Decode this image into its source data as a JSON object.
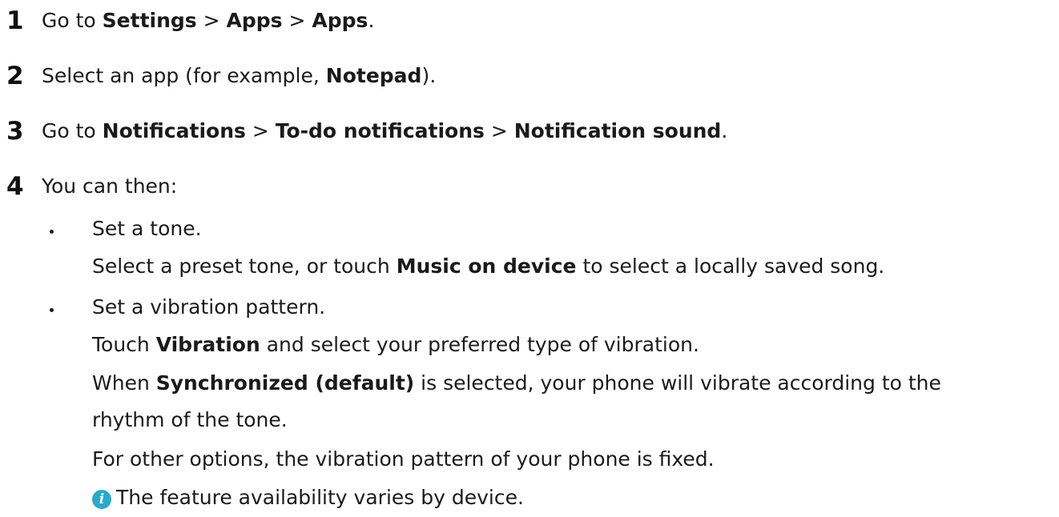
{
  "steps": [
    {
      "number": "1",
      "parts": [
        {
          "t": "Go to ",
          "b": false
        },
        {
          "t": "Settings",
          "b": true
        },
        {
          "t": " > ",
          "b": false
        },
        {
          "t": "Apps",
          "b": true
        },
        {
          "t": " > ",
          "b": false
        },
        {
          "t": "Apps",
          "b": true
        },
        {
          "t": ".",
          "b": false
        }
      ]
    },
    {
      "number": "2",
      "parts": [
        {
          "t": "Select an app (for example, ",
          "b": false
        },
        {
          "t": "Notepad",
          "b": true
        },
        {
          "t": ").",
          "b": false
        }
      ]
    },
    {
      "number": "3",
      "parts": [
        {
          "t": "Go to ",
          "b": false
        },
        {
          "t": "Notifications",
          "b": true
        },
        {
          "t": " > ",
          "b": false
        },
        {
          "t": "To-do notifications",
          "b": true
        },
        {
          "t": " > ",
          "b": false
        },
        {
          "t": "Notification sound",
          "b": true
        },
        {
          "t": ".",
          "b": false
        }
      ]
    },
    {
      "number": "4",
      "parts": [
        {
          "t": "You can then:",
          "b": false
        }
      ]
    }
  ],
  "bullets": [
    {
      "title": "Set a tone.",
      "lines": [
        [
          {
            "t": "Select a preset tone, or touch ",
            "b": false
          },
          {
            "t": "Music on device",
            "b": true
          },
          {
            "t": " to select a locally saved song.",
            "b": false
          }
        ]
      ]
    },
    {
      "title": "Set a vibration pattern.",
      "lines": [
        [
          {
            "t": "Touch ",
            "b": false
          },
          {
            "t": "Vibration",
            "b": true
          },
          {
            "t": " and select your preferred type of vibration.",
            "b": false
          }
        ],
        [
          {
            "t": "When ",
            "b": false
          },
          {
            "t": "Synchronized (default)",
            "b": true
          },
          {
            "t": " is selected, your phone will vibrate according to the",
            "b": false
          }
        ],
        [
          {
            "t": "rhythm of the tone.",
            "b": false
          }
        ],
        [
          {
            "t": "For other options, the vibration pattern of your phone is fixed.",
            "b": false
          }
        ]
      ]
    }
  ],
  "note": {
    "icon": "info-icon",
    "icon_color": "#2ba9c9",
    "glyph": "i",
    "text": "The feature availability varies by device."
  }
}
